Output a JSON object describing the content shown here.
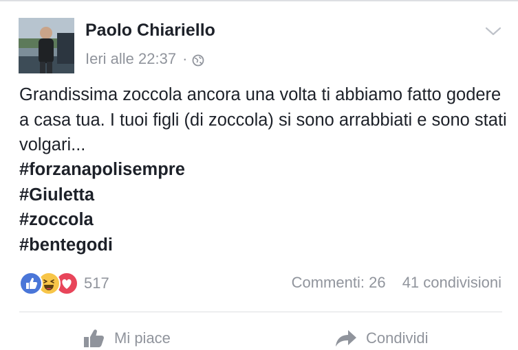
{
  "post": {
    "author": "Paolo Chiariello",
    "timestamp": "Ieri alle 22:37",
    "separator": "·",
    "privacy_icon": "globe-icon",
    "options_icon": "chevron-down-icon",
    "text": "Grandissima zoccola ancora una volta ti abbiamo fatto godere a casa tua. I tuoi figli (di zoccola) si sono arrabbiati e sono stati volgari...",
    "hashtags": [
      "#forzanapolisempre",
      "#Giuletta",
      "#zoccola",
      "#bentegodi"
    ]
  },
  "engagement": {
    "reaction_icons": [
      "like-reaction-icon",
      "haha-reaction-icon",
      "love-reaction-icon"
    ],
    "reaction_count": "517",
    "comments": "Commenti: 26",
    "shares": "41 condivisioni"
  },
  "actions": {
    "like_label": "Mi piace",
    "share_label": "Condividi"
  },
  "colors": {
    "text": "#1d2129",
    "secondary": "#90949c",
    "like_blue": "#4a76d8",
    "haha_yellow": "#f7c548",
    "love_red": "#e8455a",
    "divider": "#dddfe2"
  }
}
